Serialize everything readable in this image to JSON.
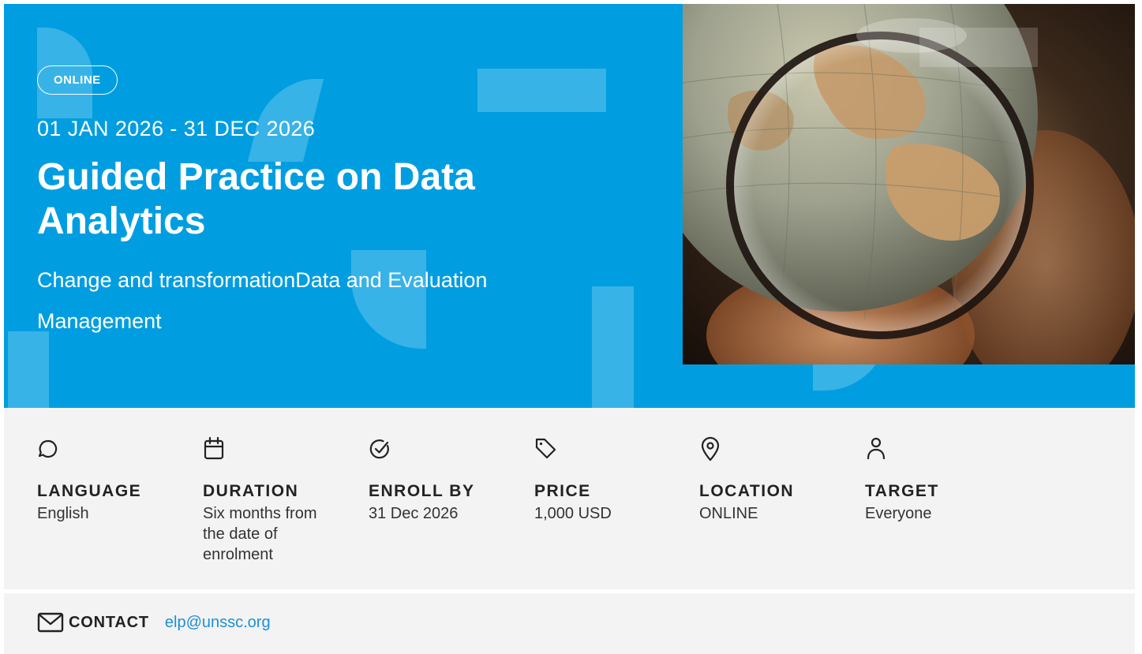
{
  "hero": {
    "badge": "ONLINE",
    "dates": "01 JAN 2026 - 31 DEC 2026",
    "title": "Guided Practice on Data Analytics",
    "subtitle": "Change and transformationData and Evaluation Management",
    "accent_color": "#009ee0"
  },
  "info": {
    "items": [
      {
        "icon": "speech-bubble-icon",
        "label": "LANGUAGE",
        "value": "English"
      },
      {
        "icon": "calendar-icon",
        "label": "DURATION",
        "value": "Six months from the date of enrolment"
      },
      {
        "icon": "check-circle-icon",
        "label": "ENROLL BY",
        "value": "31 Dec 2026"
      },
      {
        "icon": "price-tag-icon",
        "label": "PRICE",
        "value": "1,000 USD"
      },
      {
        "icon": "location-pin-icon",
        "label": "LOCATION",
        "value": "ONLINE"
      },
      {
        "icon": "person-icon",
        "label": "TARGET",
        "value": "Everyone"
      }
    ]
  },
  "contact": {
    "icon": "envelope-icon",
    "label": "CONTACT",
    "email": "elp@unssc.org",
    "link_color": "#1c8fd6"
  }
}
